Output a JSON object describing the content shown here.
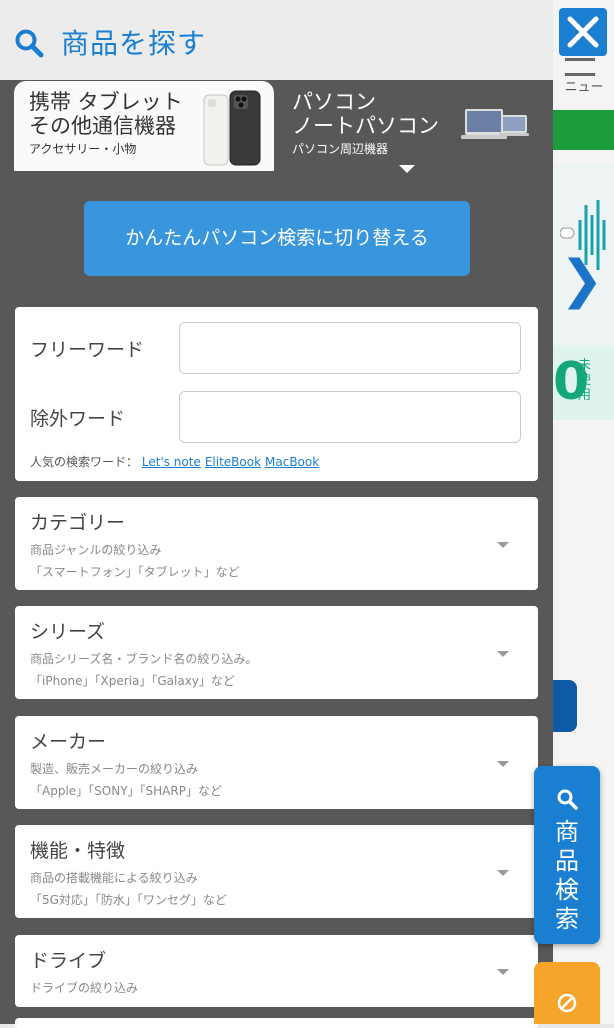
{
  "background": {
    "menu_label": "ニュー",
    "new_label": "未使用",
    "zero": "0"
  },
  "header": {
    "title": "商品を探す"
  },
  "tabs": [
    {
      "line1": "携帯 タブレット",
      "line2": "その他通信機器",
      "sub": "アクセサリー・小物"
    },
    {
      "line1": "パソコン",
      "line2": "ノートパソコン",
      "sub": "パソコン周辺機器"
    }
  ],
  "easy_search_button": "かんたんパソコン検索に切り替える",
  "free_word": {
    "label": "フリーワード",
    "value": "",
    "exclude_label": "除外ワード",
    "exclude_value": "",
    "popular_label": "人気の検索ワード：",
    "popular_words": [
      "Let's note",
      "EliteBook",
      "MacBook"
    ]
  },
  "filters": [
    {
      "title": "カテゴリー",
      "desc": "商品ジャンルの絞り込み",
      "examples": "「スマートフォン」「タブレット」など"
    },
    {
      "title": "シリーズ",
      "desc": "商品シリーズ名・ブランド名の絞り込み。",
      "examples": "「iPhone」「Xperia」「Galaxy」など"
    },
    {
      "title": "メーカー",
      "desc": "製造、販売メーカーの絞り込み",
      "examples": "「Apple」「SONY」「SHARP」など"
    },
    {
      "title": "機能・特徴",
      "desc": "商品の搭載機能による絞り込み",
      "examples": "「5G対応」「防水」「ワンセグ」など"
    },
    {
      "title": "ドライブ",
      "desc": "ドライブの絞り込み",
      "examples": ""
    }
  ],
  "search_button": "商品検索",
  "colors": {
    "accent": "#1a7fd0",
    "panel": "#585858",
    "clear": "#f5a52a"
  }
}
